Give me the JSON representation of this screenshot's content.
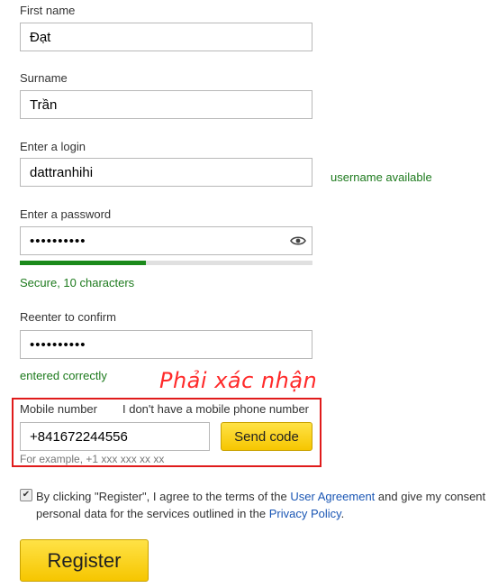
{
  "form": {
    "first_name": {
      "label": "First name",
      "value": "Đạt"
    },
    "surname": {
      "label": "Surname",
      "value": "Trần"
    },
    "login": {
      "label": "Enter a login",
      "value": "dattranhihi",
      "status": "username available"
    },
    "password": {
      "label": "Enter a password",
      "value": "••••••••••",
      "strength_text": "Secure, 10 characters",
      "strength_fraction": 0.43
    },
    "confirm": {
      "label": "Reenter to confirm",
      "value": "••••••••••",
      "status": "entered correctly"
    },
    "mobile": {
      "label": "Mobile number",
      "no_phone_link": "I don't have a mobile phone number",
      "value": "+841672244556",
      "send_code_label": "Send code",
      "hint": "For example, +1 xxx xxx xx xx"
    },
    "agreement": {
      "checked": true,
      "checkmark": "✔",
      "text_before": "By clicking \"Register\", I agree to the terms of the ",
      "user_agreement_link": "User Agreement",
      "text_middle": " and give my consent personal data for the services outlined in the ",
      "privacy_link": "Privacy Policy",
      "text_after": "."
    },
    "register_label": "Register"
  },
  "annotation": {
    "text": "Phải xác nhận",
    "color": "#ff2a2a"
  },
  "colors": {
    "accent_yellow": "#f6c600",
    "success_green": "#1d7a1d",
    "link_blue": "#1a56b4",
    "annotation_red": "#e01b1b"
  },
  "icons": {
    "password_toggle": "eye-icon"
  }
}
